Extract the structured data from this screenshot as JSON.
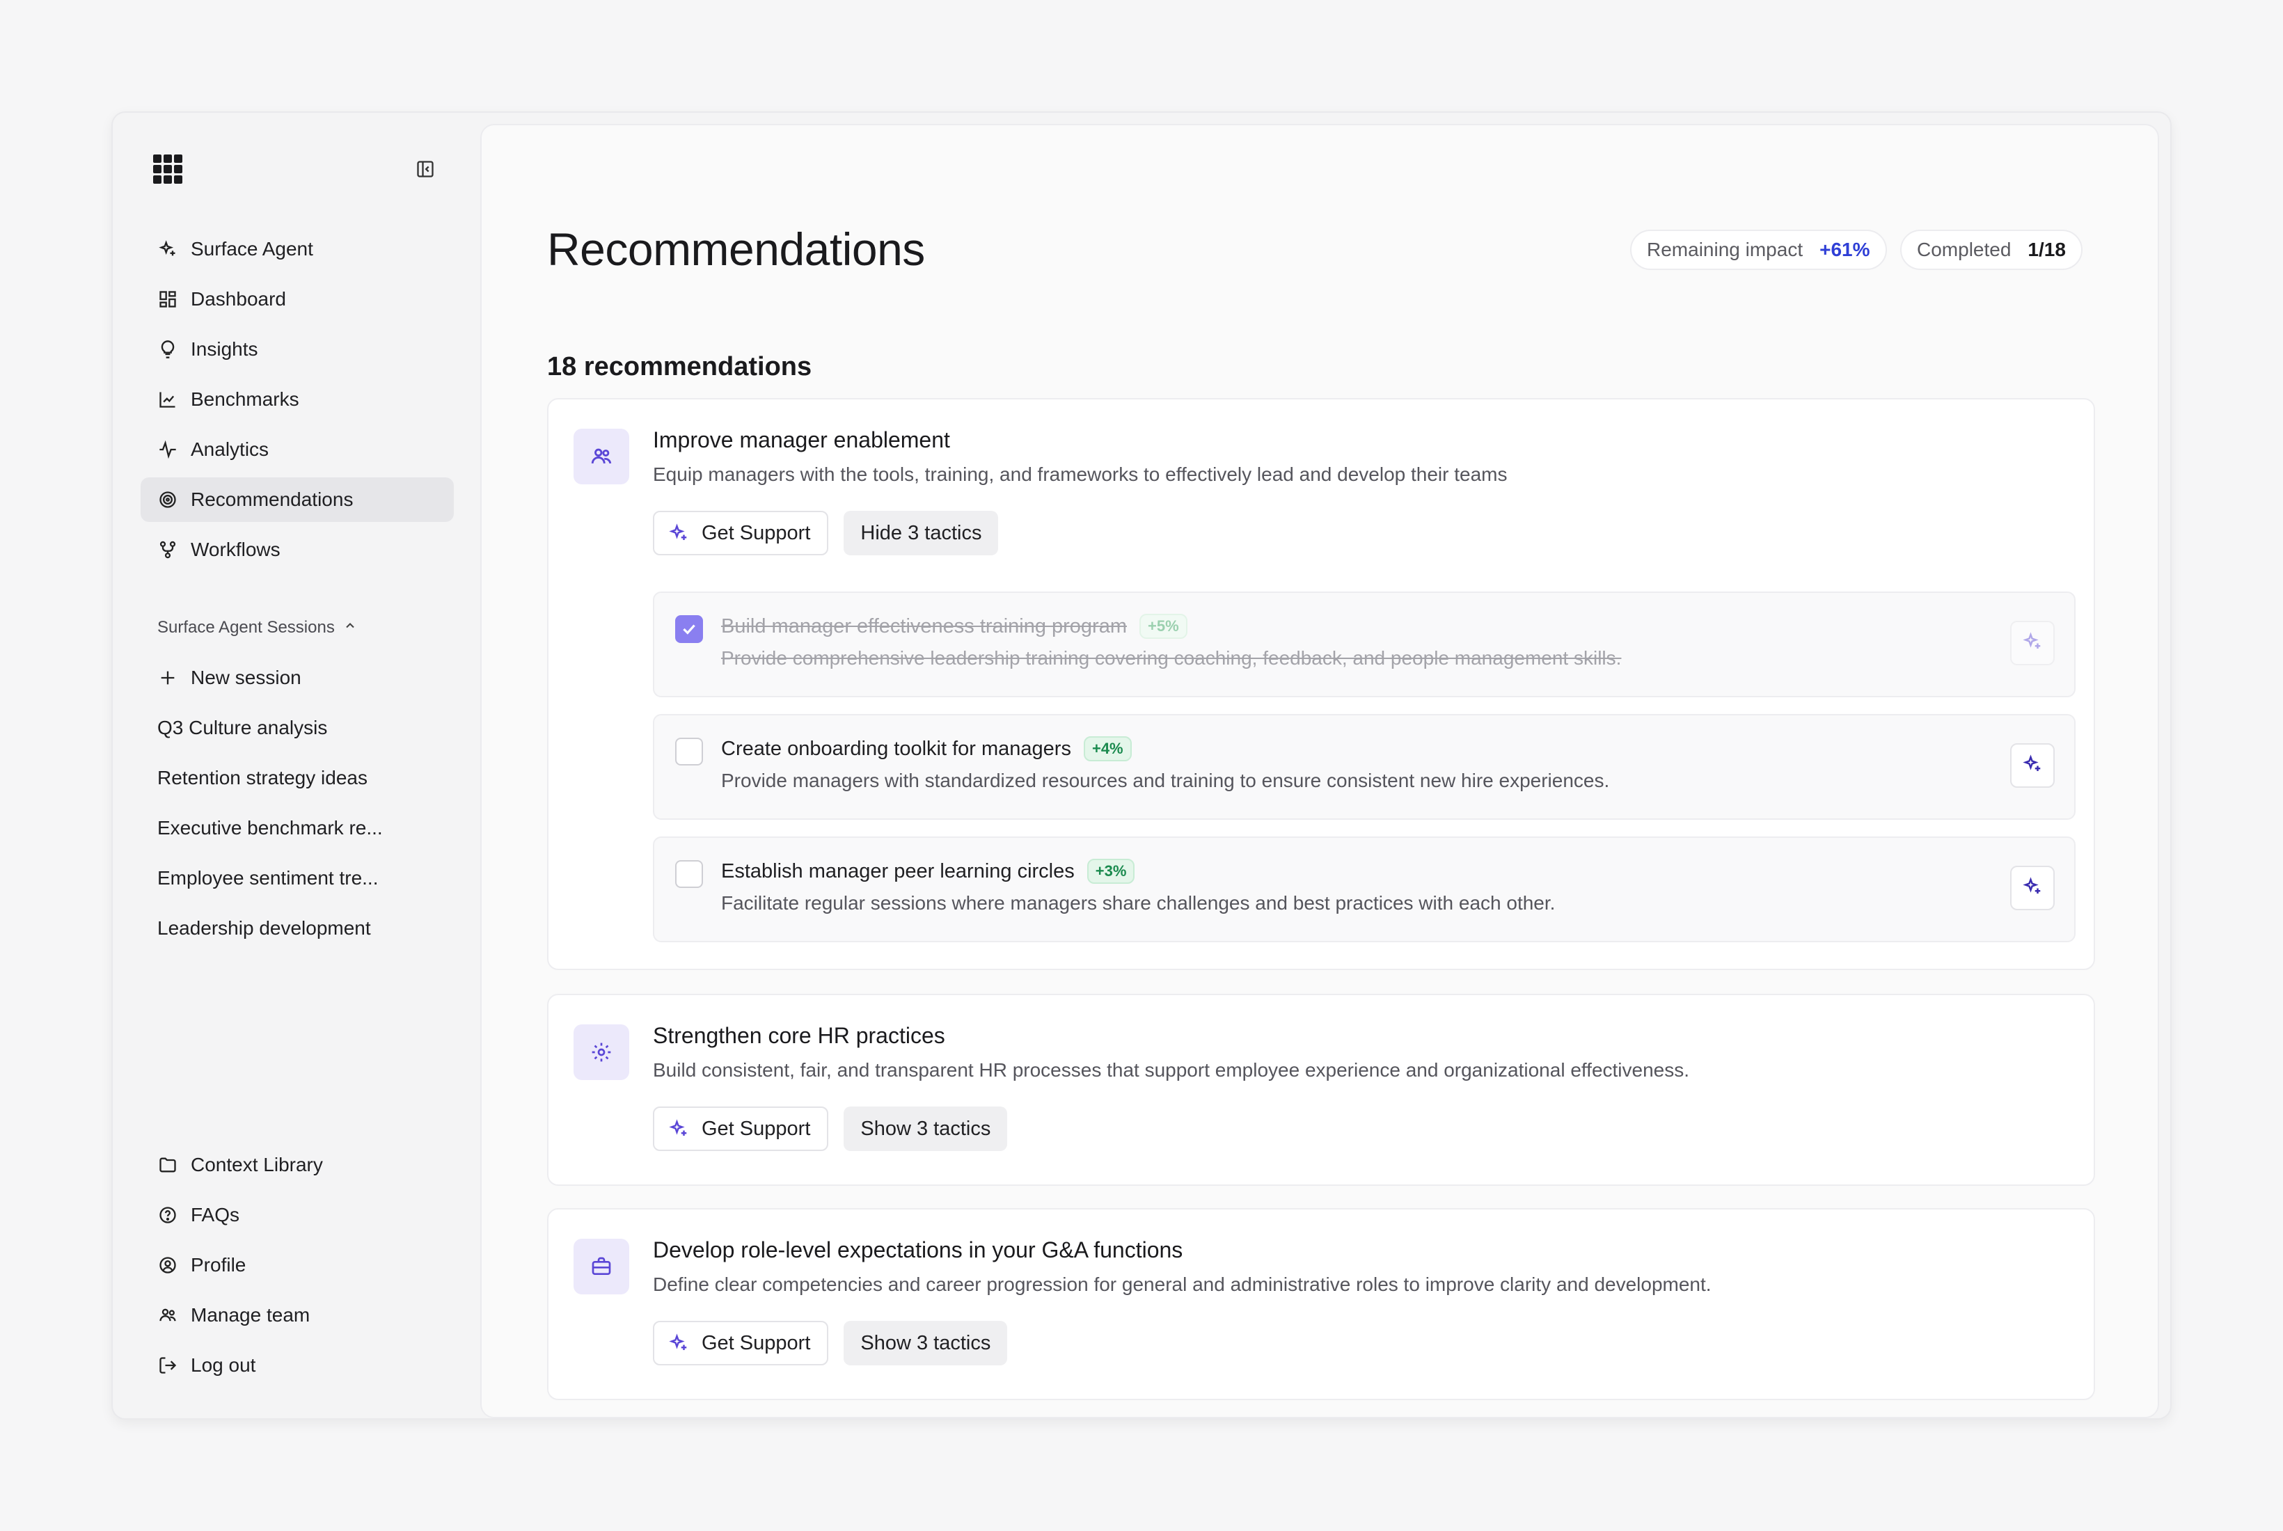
{
  "sidebar": {
    "nav": [
      {
        "label": "Surface Agent",
        "icon": "sparkle-icon"
      },
      {
        "label": "Dashboard",
        "icon": "dashboard-icon"
      },
      {
        "label": "Insights",
        "icon": "lightbulb-icon"
      },
      {
        "label": "Benchmarks",
        "icon": "chart-line-icon"
      },
      {
        "label": "Analytics",
        "icon": "activity-icon"
      },
      {
        "label": "Recommendations",
        "icon": "target-icon",
        "active": true
      },
      {
        "label": "Workflows",
        "icon": "workflow-icon"
      }
    ],
    "sessions_title": "Surface Agent Sessions",
    "new_session": "New session",
    "sessions": [
      "Q3 Culture analysis",
      "Retention strategy ideas",
      "Executive benchmark re...",
      "Employee sentiment tre...",
      "Leadership development"
    ],
    "bottom": [
      {
        "label": "Context Library",
        "icon": "folder-icon"
      },
      {
        "label": "FAQs",
        "icon": "help-circle-icon"
      },
      {
        "label": "Profile",
        "icon": "user-circle-icon"
      },
      {
        "label": "Manage team",
        "icon": "users-icon"
      },
      {
        "label": "Log out",
        "icon": "logout-icon"
      }
    ]
  },
  "main": {
    "title": "Recommendations",
    "remaining_impact_label": "Remaining impact",
    "remaining_impact_value": "+61%",
    "completed_label": "Completed",
    "completed_value": "1/18",
    "count_title": "18 recommendations",
    "cards": [
      {
        "title": "Improve manager enablement",
        "desc": "Equip managers with the tools, training, and frameworks to effectively lead and develop their teams",
        "support": "Get Support",
        "toggle": "Hide 3 tactics",
        "icon": "users-icon",
        "tactics": [
          {
            "title": "Build manager effectiveness training program",
            "badge": "+5%",
            "desc": "Provide comprehensive leadership training covering coaching, feedback, and people management skills.",
            "done": true
          },
          {
            "title": "Create onboarding toolkit for managers",
            "badge": "+4%",
            "desc": "Provide managers with standardized resources and training to ensure consistent new hire experiences.",
            "done": false
          },
          {
            "title": "Establish manager peer learning circles",
            "badge": "+3%",
            "desc": "Facilitate regular sessions where managers share challenges and best practices with each other.",
            "done": false
          }
        ]
      },
      {
        "title": "Strengthen core HR practices",
        "desc": "Build consistent, fair, and transparent HR processes that support employee experience and organizational effectiveness.",
        "support": "Get Support",
        "toggle": "Show 3 tactics",
        "icon": "gear-icon"
      },
      {
        "title": "Develop role-level expectations in your G&A functions",
        "desc": "Define clear competencies and career progression for general and administrative roles to improve clarity and development.",
        "support": "Get Support",
        "toggle": "Show 3 tactics",
        "icon": "briefcase-icon"
      }
    ]
  },
  "colors": {
    "accent": "#5a46d6",
    "impact_blue": "#2f3fd6",
    "badge_green": "#1a8a4e"
  }
}
